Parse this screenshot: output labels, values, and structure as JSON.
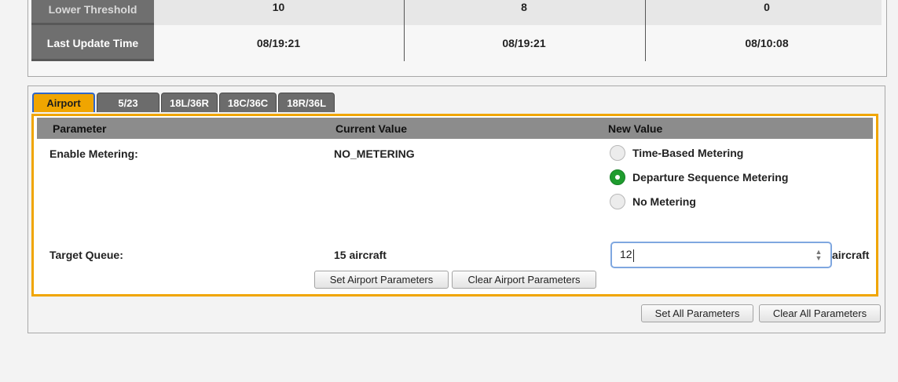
{
  "status_table": {
    "rows": [
      {
        "label": "Lower Threshold",
        "values": [
          "10",
          "8",
          "0"
        ]
      },
      {
        "label": "Last Update Time",
        "values": [
          "08/19:21",
          "08/19:21",
          "08/10:08"
        ]
      }
    ]
  },
  "tabs": [
    {
      "label": "Airport",
      "active": true
    },
    {
      "label": "5/23",
      "active": false
    },
    {
      "label": "18L/36R",
      "active": false
    },
    {
      "label": "18C/36C",
      "active": false
    },
    {
      "label": "18R/36L",
      "active": false
    }
  ],
  "params_table": {
    "headers": {
      "parameter": "Parameter",
      "current": "Current Value",
      "new": "New Value"
    },
    "metering": {
      "label": "Enable Metering:",
      "current": "NO_METERING",
      "options": [
        {
          "label": "Time-Based Metering",
          "checked": false
        },
        {
          "label": "Departure Sequence Metering",
          "checked": true
        },
        {
          "label": "No Metering",
          "checked": false
        }
      ]
    },
    "target_queue": {
      "label": "Target Queue:",
      "current": "15 aircraft",
      "input_value": "12",
      "unit": "aircraft"
    }
  },
  "buttons": {
    "set_airport": "Set Airport Parameters",
    "clear_airport": "Clear Airport Parameters",
    "set_all": "Set All Parameters",
    "clear_all": "Clear All Parameters"
  },
  "colors": {
    "accent_orange": "#f0a500",
    "radio_selected": "#1f9c2e",
    "header_gray": "#8c8c8c",
    "label_gray": "#6f6f6f"
  },
  "icons": {
    "spinner": "up-down-spinner-icon"
  }
}
